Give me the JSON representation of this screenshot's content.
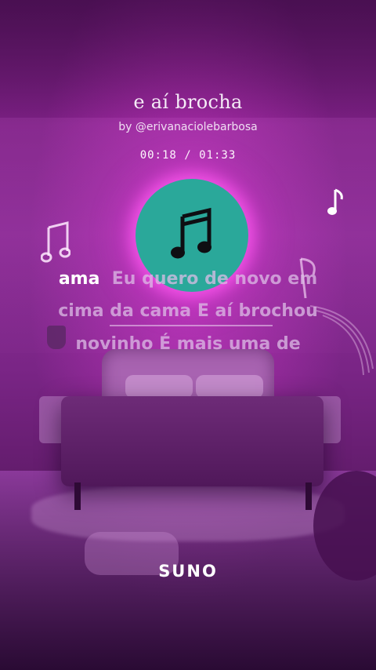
{
  "song": {
    "title": "e aí brocha",
    "author": "by @erivanaciolebarbosa",
    "time": "00:18 / 01:33"
  },
  "lyrics": {
    "line1": {
      "sung": "ama",
      "rest": "Eu quero de novo em"
    },
    "line2": {
      "text": "cima da cama  E aí brochou"
    },
    "line3": {
      "text": "novinho É mais uma de"
    }
  },
  "brand": {
    "label": "SUNO"
  },
  "icons": {
    "center": "music-note-icon",
    "decor": [
      "music-note-icon",
      "music-note-icon",
      "music-note-icon"
    ]
  },
  "colors": {
    "disc": "#2aa89a",
    "glow": "#ff5af0",
    "background": "#7a1f82"
  }
}
